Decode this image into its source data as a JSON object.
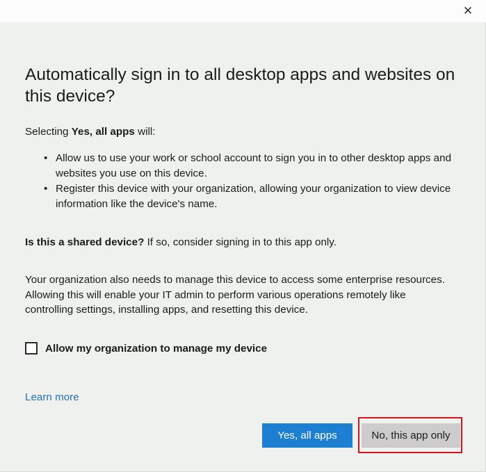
{
  "dialog": {
    "close_glyph": "✕",
    "heading": "Automatically sign in to all desktop apps and websites on this device?",
    "intro": {
      "prefix": "Selecting ",
      "bold": "Yes, all apps",
      "suffix": " will:"
    },
    "bullets": [
      {
        "symbol": "•",
        "text": "Allow us to use your work or school account to sign you in to other desktop apps and websites you use on this device."
      },
      {
        "symbol": "•",
        "text": "Register this device with your organization, allowing your organization to view device information like the device's name."
      }
    ],
    "shared": {
      "bold": "Is this a shared device?",
      "rest": " If so, consider signing in to this app only."
    },
    "manage_text": "Your organization also needs to manage this device to access some enterprise resources. Allowing this will enable your IT admin to perform various operations remotely like controlling settings, installing apps, and resetting this device.",
    "checkbox": {
      "label": "Allow my organization to manage my device",
      "checked": false
    },
    "learn_more": "Learn more",
    "buttons": {
      "primary": "Yes, all apps",
      "secondary": "No, this app only"
    },
    "colors": {
      "background": "#eef1ee",
      "primary_button": "#1d7fd2",
      "secondary_button": "#cccccc",
      "link": "#2a70b7",
      "highlight_box": "#d8141a"
    }
  }
}
